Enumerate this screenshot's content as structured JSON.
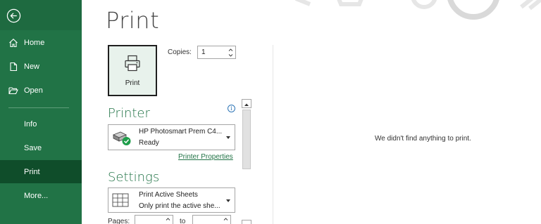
{
  "sidebar": {
    "back_icon": "back-arrow-icon",
    "items": [
      {
        "label": "Home",
        "icon": "home-icon"
      },
      {
        "label": "New",
        "icon": "new-document-icon"
      },
      {
        "label": "Open",
        "icon": "open-folder-icon"
      },
      {
        "label": "Info"
      },
      {
        "label": "Save"
      },
      {
        "label": "Print"
      },
      {
        "label": "More..."
      }
    ],
    "active": "Print",
    "colors": {
      "background": "#217346",
      "active": "#0f4d2a"
    }
  },
  "main": {
    "title": "Print",
    "print_button": {
      "label": "Print",
      "icon": "printer-icon"
    },
    "copies": {
      "label": "Copies:",
      "value": "1"
    },
    "printer_section": {
      "heading": "Printer",
      "info_icon": "i",
      "name": "HP Photosmart Prem C4...",
      "status": "Ready",
      "properties_link": "Printer Properties"
    },
    "settings_section": {
      "heading": "Settings",
      "option_title": "Print Active Sheets",
      "option_desc": "Only print the active she...",
      "pages_label": "Pages:",
      "to_label": "to"
    },
    "preview": {
      "message": "We didn't find anything to print."
    }
  }
}
